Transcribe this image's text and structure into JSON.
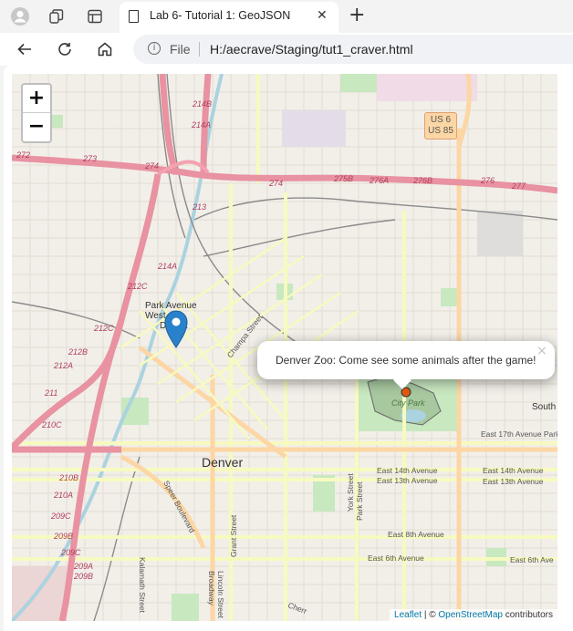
{
  "browser": {
    "tab_title": "Lab 6- Tutorial 1: GeoJSON",
    "close_glyph": "✕",
    "new_tab_glyph": "+",
    "address_scheme": "File",
    "address_url": "H:/aecrave/Staging/tut1_craver.html"
  },
  "map": {
    "zoom_in_label": "+",
    "zoom_out_label": "−",
    "popup_text": "Denver Zoo: Come see some animals after the game!",
    "popup_close": "×",
    "attribution": {
      "leaflet": "Leaflet",
      "separator": " | © ",
      "osm": "OpenStreetMap",
      "suffix": " contributors"
    },
    "shield_text": "US 6\nUS 85",
    "labels": {
      "denver": "Denver",
      "park_avenue": "Park Avenue",
      "west": "West",
      "district": "District",
      "city_park": "City Park",
      "south": "South",
      "e17th": "East 17th Avenue Parkw",
      "e14th": "East 14th Avenue",
      "e13th": "East 13th Avenue",
      "e8th": "East 8th Avenue",
      "e6th": "East 6th Avenue",
      "e6th_b": "East 6th Ave",
      "champa": "Champa Street",
      "speer": "Speer Boulevard",
      "grant": "Grant Street",
      "york": "York Street",
      "park": "Park Street",
      "kalamath": "Kalamath Street",
      "lincoln": "Lincoln Street",
      "broadway": "Broadway",
      "cherry": "Cherr"
    },
    "exits": [
      "272",
      "273",
      "274",
      "274",
      "275B",
      "276A",
      "276B",
      "276",
      "277",
      "214B",
      "214A",
      "213",
      "212C",
      "212C",
      "212B",
      "212A",
      "211",
      "210C",
      "210B",
      "210A",
      "209C",
      "209B",
      "209C",
      "209A",
      "209B",
      "214A"
    ]
  }
}
